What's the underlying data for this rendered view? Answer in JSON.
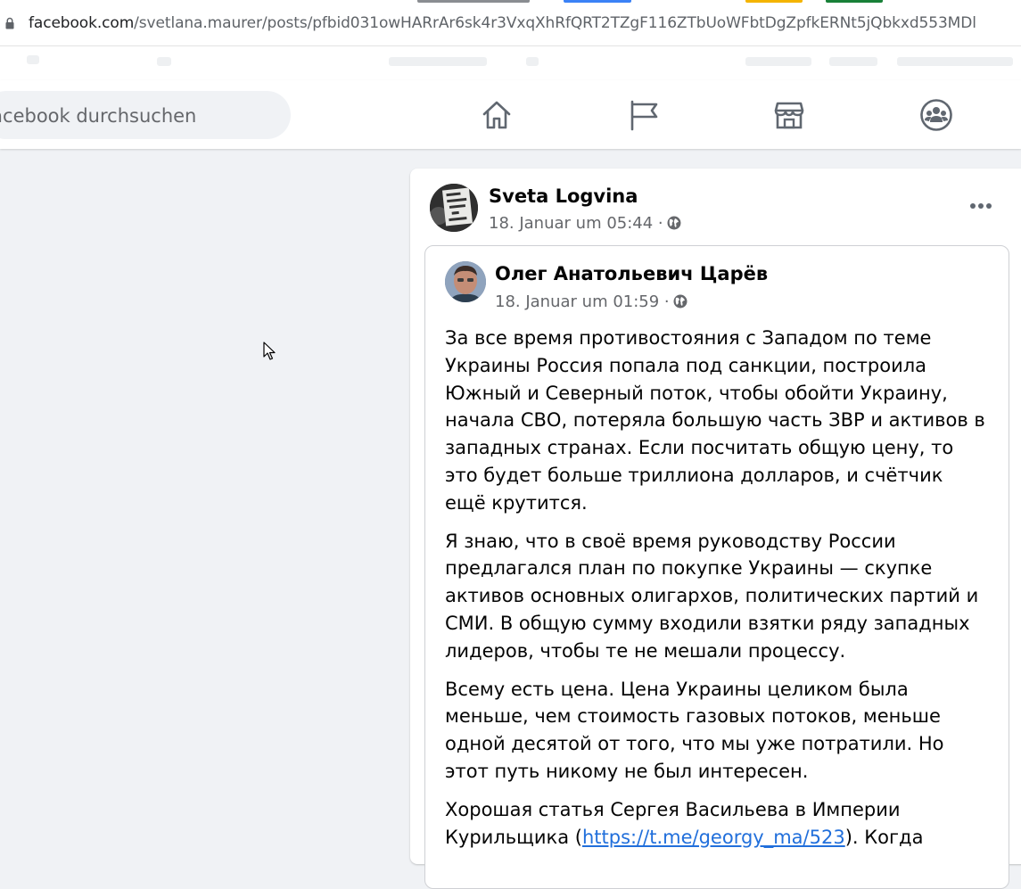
{
  "browser": {
    "url_host": "facebook.com",
    "url_path": "/svetlana.maurer/posts/pfbid031owHARrAr6sk4r3VxqXhRfQRT2TZgF116ZTbUoWFbtDgZpfkERNt5jQbkxd553MDl"
  },
  "header": {
    "search_placeholder": "Facebook durchsuchen",
    "nav": [
      {
        "name": "home-icon"
      },
      {
        "name": "pages-flag-icon"
      },
      {
        "name": "marketplace-icon"
      },
      {
        "name": "groups-icon"
      }
    ]
  },
  "post": {
    "author": "Sveta Logvina",
    "date": "18. Januar um 05:44 ·",
    "avatar_sign_text": "I'M ALREADY AGAINST THE NEXT WAR",
    "shared": {
      "author": "Олег Анатольевич Царёв",
      "date": "18. Januar um 01:59 ·",
      "paragraphs": [
        "За все время противостояния с Западом по теме Украины Россия попала под санкции, построила Южный и Северный поток, чтобы обойти Украину, начала СВО, потеряла большую часть ЗВР и активов в западных странах. Если посчитать общую цену, то это будет больше триллиона долларов, и счётчик ещё крутится.",
        "Я знаю, что в своё время руководству России предлагался план по покупке Украины — скупке активов основных олигархов, политических партий и СМИ. В общую сумму входили взятки ряду западных лидеров, чтобы те не мешали процессу.",
        "Всему есть цена. Цена Украины целиком была меньше, чем стоимость газовых потоков, меньше одной десятой от того, что мы уже потратили. Но этот путь никому не был интересен."
      ],
      "last_paragraph_start": "Хорошая статья Сергея Васильева в Империи Курильщика (",
      "link_text": "https://t.me/georgy_ma/523",
      "last_paragraph_end": "). Когда"
    }
  },
  "colors": {
    "page_bg": "#f0f2f5",
    "card_bg": "#ffffff",
    "link": "#216fdb",
    "secondary_text": "#65676b"
  }
}
